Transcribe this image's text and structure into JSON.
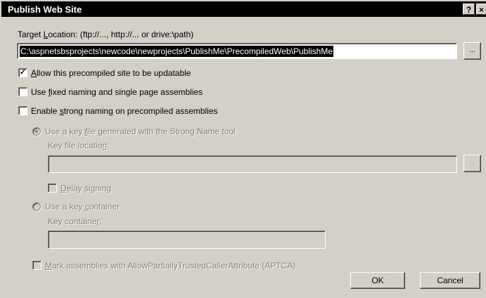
{
  "window": {
    "title": "Publish Web Site",
    "help_glyph": "?",
    "close_glyph": "×"
  },
  "target": {
    "label_pre": "Target ",
    "label_accel": "L",
    "label_post": "ocation: (ftp://..., http://... or drive:\\path)",
    "value": "C:\\aspnetsbsprojects\\newcode\\newprojects\\PublishMe\\PrecompiledWeb\\PublishMe",
    "browse_label": "..."
  },
  "options": {
    "updatable": {
      "accel": "A",
      "rest": "llow this precompiled site to be updatable",
      "checked": true,
      "mark": "✓"
    },
    "fixed_naming": {
      "pre": "Use ",
      "accel": "f",
      "rest": "ixed naming and single page assemblies",
      "checked": false
    },
    "strong_naming": {
      "pre": "Enable ",
      "accel": "s",
      "rest": "trong naming on precompiled assemblies",
      "checked": false
    }
  },
  "strong_name": {
    "keyfile_radio": {
      "pre": "Use a key ",
      "accel": "f",
      "rest": "ile generated with the Strong Name tool",
      "selected": true
    },
    "keyfile_label": {
      "pre": "Key file locatio",
      "accel": "n",
      "rest": ":"
    },
    "keyfile_value": "",
    "browse_label": "...",
    "delay_signing": {
      "accel": "D",
      "rest": "elay signing",
      "checked": false
    },
    "container_radio": {
      "pre": "Use a key ",
      "accel": "c",
      "rest": "ontainer",
      "selected": false
    },
    "container_label": {
      "pre": "Key containe",
      "accel": "r",
      "rest": ":"
    },
    "container_value": ""
  },
  "aptca": {
    "accel": "M",
    "rest": "ark assemblies with AllowPartiallyTrustedCallerAttribute (APTCA)",
    "checked": false
  },
  "buttons": {
    "ok": "OK",
    "cancel": "Cancel"
  }
}
